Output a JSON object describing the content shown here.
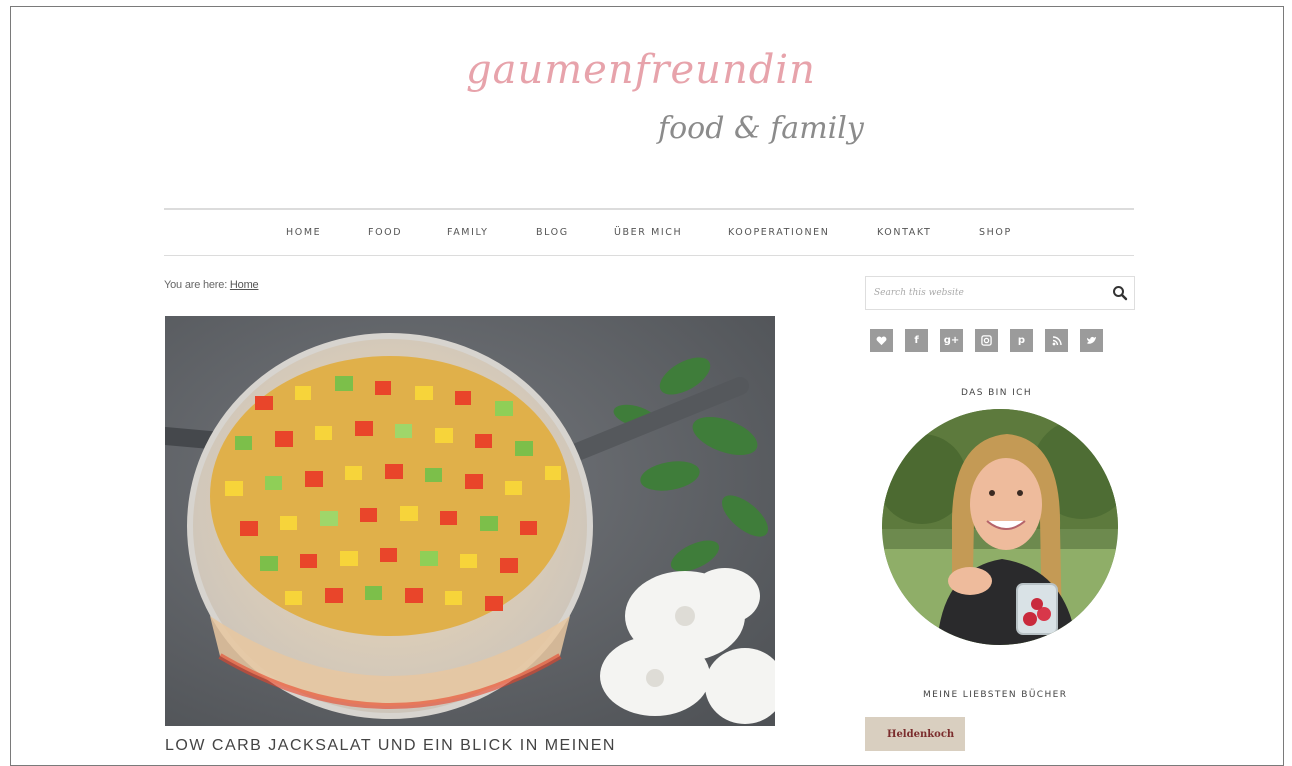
{
  "site": {
    "logo_main": "gaumenfreundin",
    "logo_sub": "food & family"
  },
  "nav": {
    "items": [
      {
        "label": "HOME"
      },
      {
        "label": "FOOD"
      },
      {
        "label": "FAMILY"
      },
      {
        "label": "BLOG"
      },
      {
        "label": "ÜBER MICH"
      },
      {
        "label": "KOOPERATIONEN"
      },
      {
        "label": "KONTAKT"
      },
      {
        "label": "SHOP"
      }
    ]
  },
  "breadcrumb": {
    "prefix": "You are here:",
    "link": "Home"
  },
  "post": {
    "title": "LOW CARB JACKSALAT UND EIN BLICK IN MEINEN"
  },
  "sidebar": {
    "search_placeholder": "Search this website",
    "social_icons": [
      "heart-icon",
      "facebook-icon",
      "google-plus-icon",
      "instagram-icon",
      "pinterest-icon",
      "rss-icon",
      "twitter-icon"
    ],
    "about_title": "DAS BIN ICH",
    "books_title": "MEINE LIEBSTEN BÜCHER",
    "book_label": "Heldenkoch"
  },
  "colors": {
    "logo_pink": "#e7a3ab",
    "logo_gray": "#8b8b8b",
    "icon_gray": "#9b9b9b",
    "rule_gray": "#dcdcdc"
  }
}
